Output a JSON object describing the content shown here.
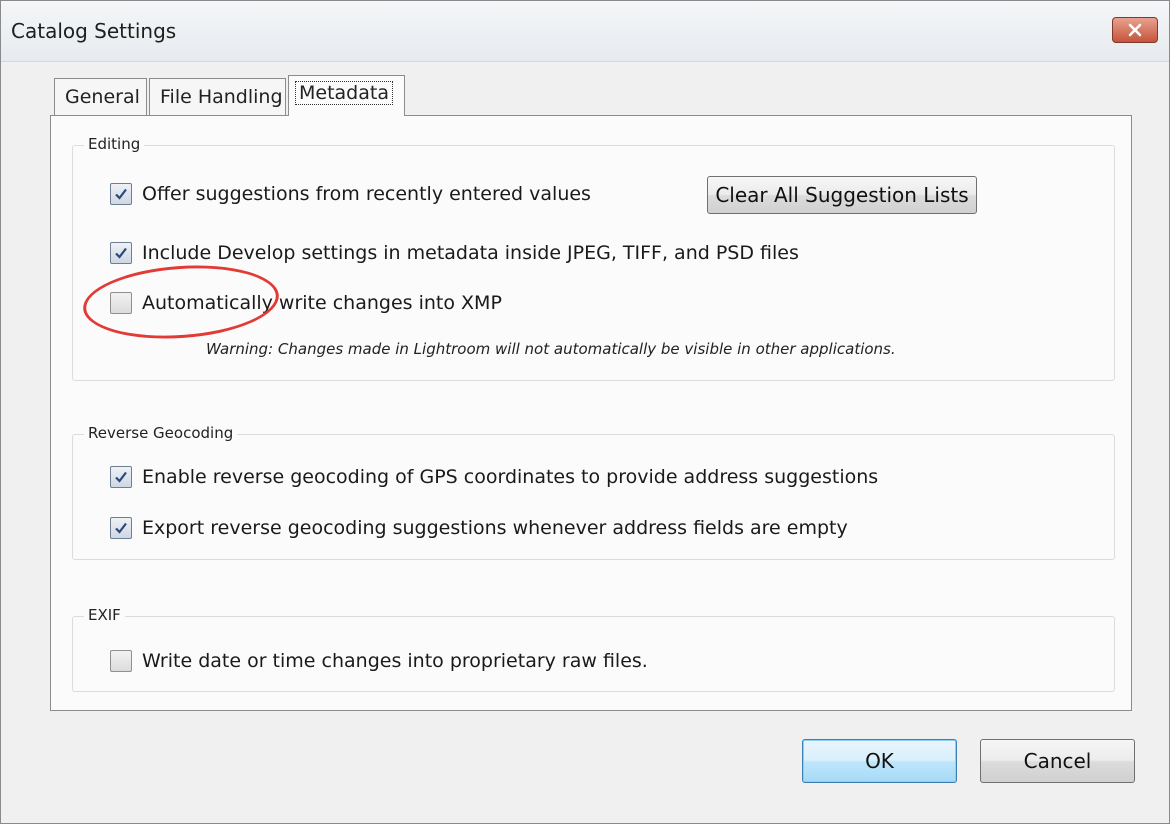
{
  "window": {
    "title": "Catalog Settings"
  },
  "tabs": [
    {
      "label": "General",
      "active": false
    },
    {
      "label": "File Handling",
      "active": false
    },
    {
      "label": "Metadata",
      "active": true
    }
  ],
  "editing": {
    "title": "Editing",
    "offer_suggestions": {
      "label": "Offer suggestions from recently entered values",
      "checked": true
    },
    "clear_button": "Clear All Suggestion Lists",
    "include_develop": {
      "label": "Include Develop settings in metadata inside JPEG, TIFF, and PSD files",
      "checked": true
    },
    "auto_write_xmp": {
      "label": "Automatically write changes into XMP",
      "checked": false
    },
    "warning": "Warning: Changes made in Lightroom will not automatically be visible in other applications."
  },
  "reverse_geocoding": {
    "title": "Reverse Geocoding",
    "enable": {
      "label": "Enable reverse geocoding of GPS coordinates to provide address suggestions",
      "checked": true
    },
    "export": {
      "label": "Export reverse geocoding suggestions whenever address fields are empty",
      "checked": true
    }
  },
  "exif": {
    "title": "EXIF",
    "write_date_time": {
      "label": "Write date or time changes into proprietary raw files.",
      "checked": false
    }
  },
  "buttons": {
    "ok": "OK",
    "cancel": "Cancel"
  },
  "colors": {
    "annotation_circle": "#e23a34",
    "close_button": "#c6533b",
    "default_button": "#bee6fd"
  },
  "icons": {
    "close": "close-icon",
    "check": "checkmark-icon"
  }
}
